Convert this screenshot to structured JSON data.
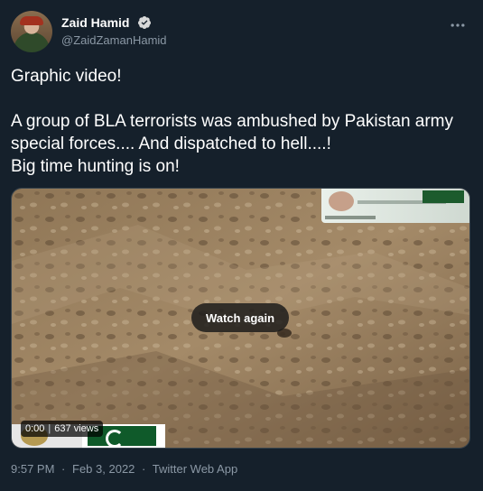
{
  "author": {
    "display_name": "Zaid Hamid",
    "handle": "@ZaidZamanHamid",
    "verified_icon": "verified-badge-icon"
  },
  "tweet": {
    "line1": "Graphic video!",
    "line2": "A group of BLA terrorists was ambushed by Pakistan army special forces.... And dispatched to hell....!",
    "line3": "Big time hunting is on!"
  },
  "media": {
    "watch_again_label": "Watch again",
    "time": "0:00",
    "views": "637 views"
  },
  "footer": {
    "time": "9:57 PM",
    "separator": "·",
    "date": "Feb 3, 2022",
    "source": "Twitter Web App"
  },
  "colors": {
    "background": "#15202b",
    "secondary_text": "#8b98a5",
    "verified": "#d9d9d9"
  }
}
